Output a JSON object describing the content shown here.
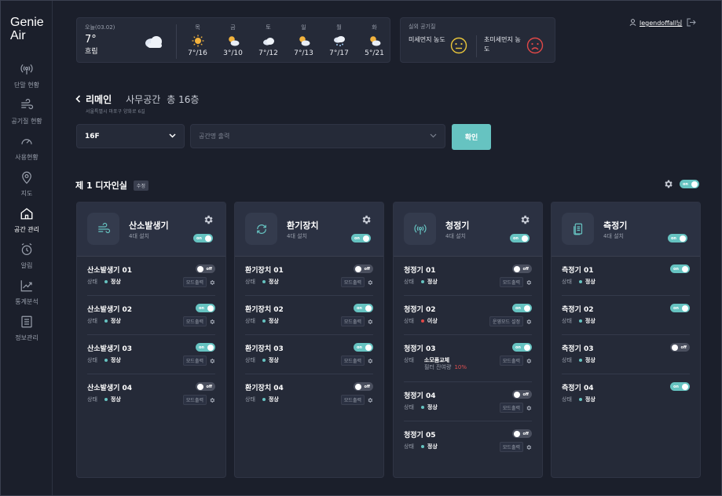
{
  "logo": {
    "line1": "Genie",
    "line2": "Air"
  },
  "nav": [
    {
      "label": "단말 현황",
      "icon": "signal-icon"
    },
    {
      "label": "공기질 현황",
      "icon": "wind-icon"
    },
    {
      "label": "사용현황",
      "icon": "gauge-icon"
    },
    {
      "label": "지도",
      "icon": "map-pin-icon"
    },
    {
      "label": "공간 관리",
      "icon": "home-icon",
      "active": true
    },
    {
      "label": "알림",
      "icon": "alarm-icon"
    },
    {
      "label": "통계분석",
      "icon": "chart-icon"
    },
    {
      "label": "정보관리",
      "icon": "list-icon"
    }
  ],
  "weather": {
    "today": {
      "date": "오늘(03.02)",
      "temp": "7°",
      "cond": "흐림",
      "icon": "cloud-icon"
    },
    "days": [
      {
        "d": "목",
        "t": "7°/16",
        "icon": "sun-icon"
      },
      {
        "d": "금",
        "t": "3°/10",
        "icon": "partly-cloudy-icon"
      },
      {
        "d": "토",
        "t": "7°/12",
        "icon": "cloud-icon"
      },
      {
        "d": "일",
        "t": "7°/13",
        "icon": "partly-cloudy-icon"
      },
      {
        "d": "월",
        "t": "7°/17",
        "icon": "snow-icon"
      },
      {
        "d": "화",
        "t": "5°/21",
        "icon": "partly-cloudy-icon"
      }
    ]
  },
  "air": {
    "title": "실외 공기질",
    "pm10": "미세먼지 농도",
    "pm25": "초미세먼지 농도",
    "pm10_color": "#e8c53a",
    "pm25_color": "#e04848"
  },
  "user": {
    "name": "legendoffall님"
  },
  "breadcrumb": {
    "name": "리메인",
    "space": "사무공간",
    "floors": "총 16층",
    "address": "서울특별시 마포구 양화로 6길"
  },
  "filters": {
    "floor": "16F",
    "space_placeholder": "공간명 출력",
    "confirm": "확인"
  },
  "room": {
    "title": "제 1 디자인실",
    "edit": "수정",
    "toggle": "on"
  },
  "accent": "#66c3c1",
  "panels": [
    {
      "name": "산소발생기",
      "count": "4대 설치",
      "icon": "wind-icon",
      "toggle": "on",
      "devices": [
        {
          "name": "산소발생기 01",
          "state_label": "상태",
          "state": "정상",
          "status": "ok",
          "toggle": "off",
          "mode": "모드출력"
        },
        {
          "name": "산소발생기 02",
          "state_label": "상태",
          "state": "정상",
          "status": "ok",
          "toggle": "on",
          "mode": "모드출력"
        },
        {
          "name": "산소발생기 03",
          "state_label": "상태",
          "state": "정상",
          "status": "ok",
          "toggle": "on",
          "mode": "모드출력"
        },
        {
          "name": "산소발생기 04",
          "state_label": "상태",
          "state": "정상",
          "status": "ok",
          "toggle": "off",
          "mode": "모드출력"
        }
      ]
    },
    {
      "name": "환기장치",
      "count": "4대 설치",
      "icon": "recycle-icon",
      "toggle": "on",
      "devices": [
        {
          "name": "환기장치 01",
          "state_label": "상태",
          "state": "정상",
          "status": "ok",
          "toggle": "off",
          "mode": "모드출력"
        },
        {
          "name": "환기장치 02",
          "state_label": "상태",
          "state": "정상",
          "status": "ok",
          "toggle": "on",
          "mode": "모드출력"
        },
        {
          "name": "환기장치 03",
          "state_label": "상태",
          "state": "정상",
          "status": "ok",
          "toggle": "on",
          "mode": "모드출력"
        },
        {
          "name": "환기장치 04",
          "state_label": "상태",
          "state": "정상",
          "status": "ok",
          "toggle": "off",
          "mode": "모드출력"
        }
      ]
    },
    {
      "name": "청정기",
      "count": "4대 설치",
      "icon": "signal-icon",
      "toggle": "on",
      "devices": [
        {
          "name": "청정기 01",
          "state_label": "상태",
          "state": "정상",
          "status": "ok",
          "toggle": "off",
          "mode": "모드출력"
        },
        {
          "name": "청정기 02",
          "state_label": "상태",
          "state": "이상",
          "status": "error",
          "toggle": "on",
          "mode": "운영모드 설정"
        },
        {
          "name": "청정기 03",
          "state_label": "상태",
          "state": "소모품교체",
          "status": "warn",
          "toggle": "on",
          "mode": "모드출력",
          "filter_label": "필터 잔여량",
          "filter_pct": "10%"
        },
        {
          "name": "청정기 04",
          "state_label": "상태",
          "state": "정상",
          "status": "ok",
          "toggle": "off",
          "mode": "모드출력"
        },
        {
          "name": "청정기 05",
          "state_label": "상태",
          "state": "정상",
          "status": "ok",
          "toggle": "off",
          "mode": "모드출력"
        }
      ]
    },
    {
      "name": "측정기",
      "count": "4대 설치",
      "icon": "device-icon",
      "toggle": "on",
      "devices": [
        {
          "name": "측정기 01",
          "state_label": "상태",
          "state": "정상",
          "status": "ok",
          "toggle": "on"
        },
        {
          "name": "측정기 02",
          "state_label": "상태",
          "state": "정상",
          "status": "ok",
          "toggle": "on"
        },
        {
          "name": "측정기 03",
          "state_label": "상태",
          "state": "정상",
          "status": "ok",
          "toggle": "off"
        },
        {
          "name": "측정기 04",
          "state_label": "상태",
          "state": "정상",
          "status": "ok",
          "toggle": "on"
        }
      ]
    }
  ]
}
